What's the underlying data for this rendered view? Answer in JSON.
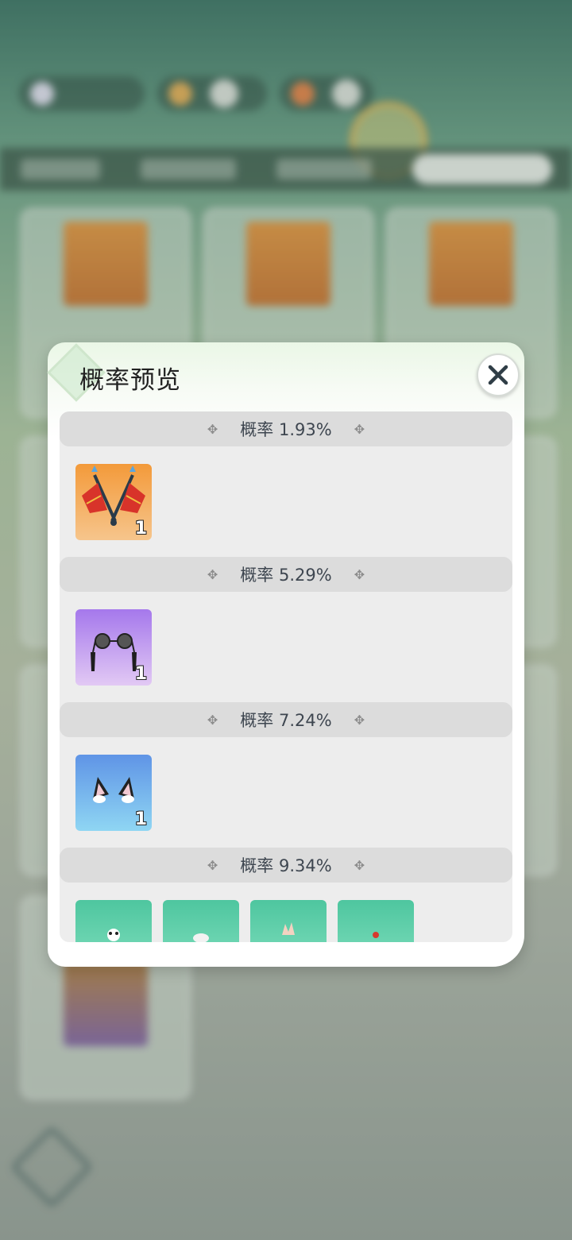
{
  "modal": {
    "title": "概率预览",
    "close_icon": "close-icon"
  },
  "tiers": [
    {
      "label": "概率 1.93%",
      "items": [
        {
          "icon": "twin-spear-weapon-icon",
          "count": "1",
          "bg": "#f39a3a"
        }
      ]
    },
    {
      "label": "概率 5.29%",
      "items": [
        {
          "icon": "round-glasses-tassel-icon",
          "count": "1",
          "bg": "#a578ec"
        }
      ]
    },
    {
      "label": "概率 7.24%",
      "items": [
        {
          "icon": "cat-ears-icon",
          "count": "1",
          "bg": "#5f94e6"
        }
      ]
    },
    {
      "label": "概率 9.34%",
      "items": [
        {
          "icon": "panda-accessory-icon",
          "bg": "#4ec69f"
        },
        {
          "icon": "cloud-accessory-icon",
          "bg": "#4ec69f"
        },
        {
          "icon": "hand-accessory-icon",
          "bg": "#4ec69f"
        },
        {
          "icon": "red-bead-accessory-icon",
          "bg": "#4ec69f"
        }
      ]
    }
  ],
  "colors": {
    "tier_header_bg": "#dcdcdc",
    "list_bg": "#ededed",
    "modal_bg": "#ffffff"
  }
}
